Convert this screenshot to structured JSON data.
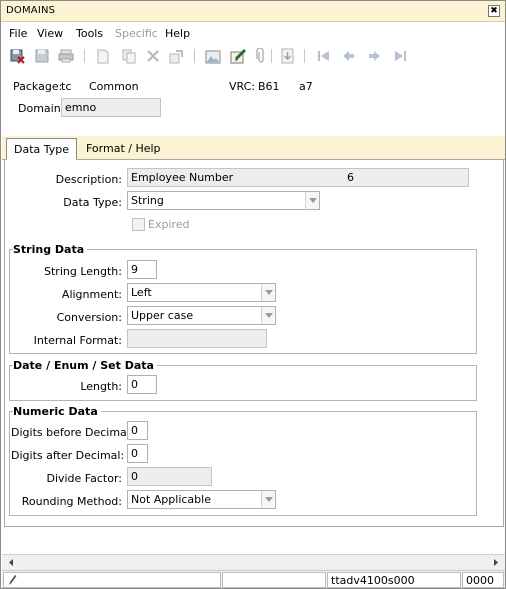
{
  "window": {
    "title": "DOMAINS",
    "close_symbol": "✖"
  },
  "menu": [
    "File",
    "View",
    "Tools",
    "Specific",
    "Help"
  ],
  "toolbar_icons": [
    "save-close-icon",
    "save-icon",
    "print-icon",
    "new-icon",
    "copy-icon",
    "delete-icon",
    "refresh-icon",
    "image-icon",
    "text-edit-icon",
    "attachment-icon",
    "export-icon",
    "first-record-icon",
    "previous-record-icon",
    "next-record-icon",
    "last-record-icon"
  ],
  "header": {
    "package_label": "Package:",
    "package_code": "tc",
    "package_name": "Common",
    "vrc_label": "VRC:",
    "vrc_value": "B61",
    "vrc_version": "a7",
    "domain_label": "Domain:",
    "domain_value": "emno"
  },
  "tabs": [
    {
      "label": "Data Type",
      "active": true
    },
    {
      "label": "Format / Help",
      "active": false
    }
  ],
  "data_type": {
    "description_label": "Description:",
    "description_value": "Employee Number",
    "description_suffix": "6",
    "data_type_label": "Data Type:",
    "data_type_value": "String",
    "expired_label": "Expired",
    "expired_checked": false
  },
  "string_data": {
    "title": "String Data",
    "length_label": "String Length:",
    "length_value": "9",
    "alignment_label": "Alignment:",
    "alignment_value": "Left",
    "conversion_label": "Conversion:",
    "conversion_value": "Upper case",
    "internal_format_label": "Internal Format:",
    "internal_format_value": ""
  },
  "date_data": {
    "title": "Date / Enum / Set Data",
    "length_label": "Length:",
    "length_value": "0"
  },
  "numeric_data": {
    "title": "Numeric Data",
    "digits_before_label": "Digits before Decimal:",
    "digits_before_value": "0",
    "digits_after_label": "Digits after Decimal:",
    "digits_after_value": "0",
    "divide_factor_label": "Divide Factor:",
    "divide_factor_value": "0",
    "rounding_label": "Rounding Method:",
    "rounding_value": "Not Applicable"
  },
  "status": {
    "session": "ttadv4100s000",
    "code": "0000"
  }
}
